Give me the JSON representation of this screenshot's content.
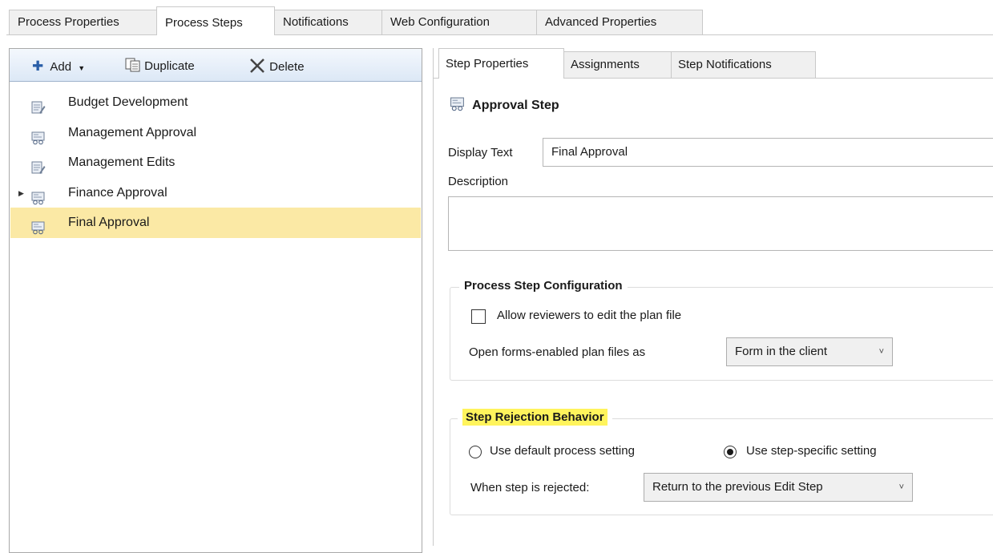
{
  "top_tabs": [
    {
      "label": "Process Properties"
    },
    {
      "label": "Process Steps"
    },
    {
      "label": "Notifications"
    },
    {
      "label": "Web Configuration"
    },
    {
      "label": "Advanced Properties"
    }
  ],
  "toolbar": {
    "add_label": "Add",
    "duplicate_label": "Duplicate",
    "delete_label": "Delete"
  },
  "steps": [
    {
      "label": "Budget Development",
      "icon": "edit-step-icon"
    },
    {
      "label": "Management Approval",
      "icon": "approval-step-icon"
    },
    {
      "label": "Management Edits",
      "icon": "edit-step-icon"
    },
    {
      "label": "Finance Approval",
      "icon": "approval-step-icon"
    },
    {
      "label": "Final Approval",
      "icon": "approval-step-icon"
    }
  ],
  "sub_tabs": [
    {
      "label": "Step Properties"
    },
    {
      "label": "Assignments"
    },
    {
      "label": "Step Notifications"
    }
  ],
  "step_header": {
    "title": "Approval Step"
  },
  "form": {
    "display_text_label": "Display Text",
    "display_text_value": "Final Approval",
    "description_label": "Description",
    "description_value": ""
  },
  "config": {
    "title": "Process Step Configuration",
    "allow_edit_label": "Allow reviewers to edit the plan file",
    "open_forms_label": "Open forms-enabled plan files as",
    "open_forms_value": "Form in the client"
  },
  "rejection": {
    "title": "Step Rejection Behavior",
    "default_label": "Use default process setting",
    "specific_label": "Use step-specific setting",
    "when_rejected_label": "When step is rejected:",
    "when_rejected_value": "Return to the previous Edit Step"
  },
  "colors": {
    "selection": "#fbe9a5",
    "highlight": "#fff45c",
    "toolbar_top": "#f4f8fd",
    "toolbar_bottom": "#dce8f6"
  }
}
